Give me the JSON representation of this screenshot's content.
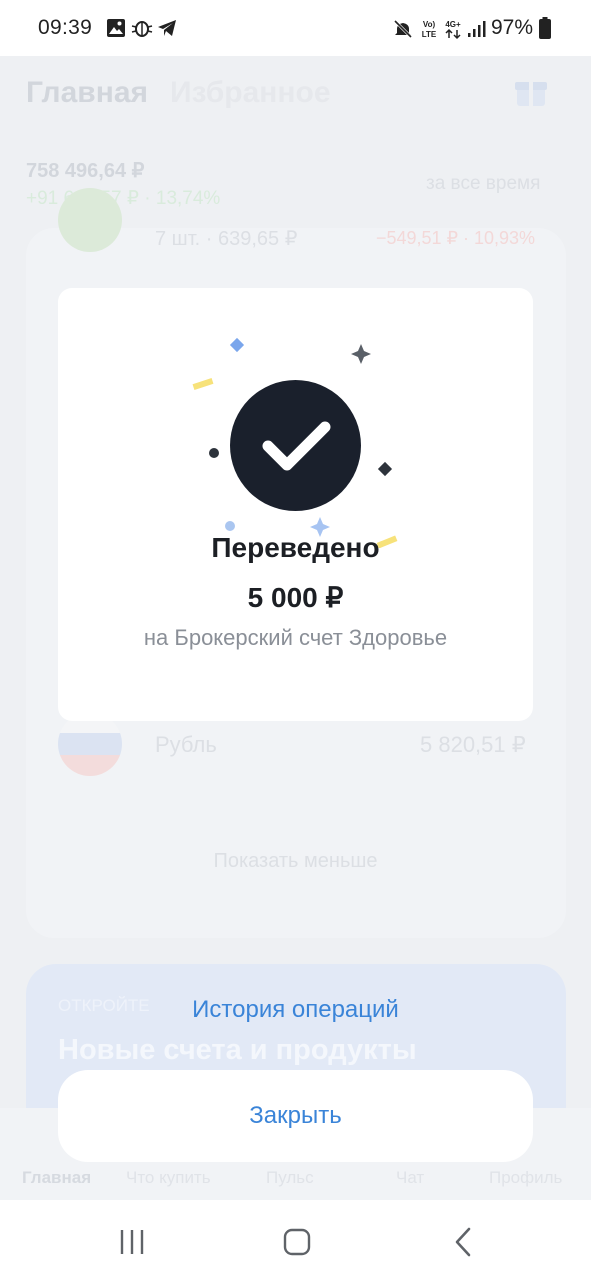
{
  "status_bar": {
    "time": "09:39",
    "battery_text": "97%",
    "left_icons": [
      "gallery-icon",
      "bug-icon",
      "telegram-icon"
    ],
    "right_icons": [
      "mute-icon",
      "volte-icon",
      "network-4g-icon",
      "signal-icon",
      "battery-icon"
    ]
  },
  "background": {
    "tabs": [
      "Главная",
      "Избранное"
    ],
    "portfolio_value": "758 496,64 ₽",
    "portfolio_change": "+91 661,57 ₽ · 13,74%",
    "period": "за все время",
    "asset_row": {
      "qty": "7 шт. · 639,65 ₽",
      "change": "−549,51 ₽ · 10,93%"
    },
    "currency_row": {
      "name": "Рубль",
      "value": "5 820,51 ₽"
    },
    "show_less": "Показать меньше",
    "promo_label": "ОТКРОЙТЕ",
    "promo_title": "Новые счета и продукты",
    "bottom_tabs": [
      "Главная",
      "Что купить",
      "Пульс",
      "Чат",
      "Профиль"
    ]
  },
  "modal": {
    "title": "Переведено",
    "amount": "5 000 ₽",
    "subtitle": "на Брокерский счет Здоровье"
  },
  "actions": {
    "history": "История операций",
    "close": "Закрыть"
  },
  "colors": {
    "accent": "#3a84d8",
    "check_circle": "#1a202c",
    "modal_bg": "#ffffff",
    "screen_bg": "#eef0f3"
  }
}
